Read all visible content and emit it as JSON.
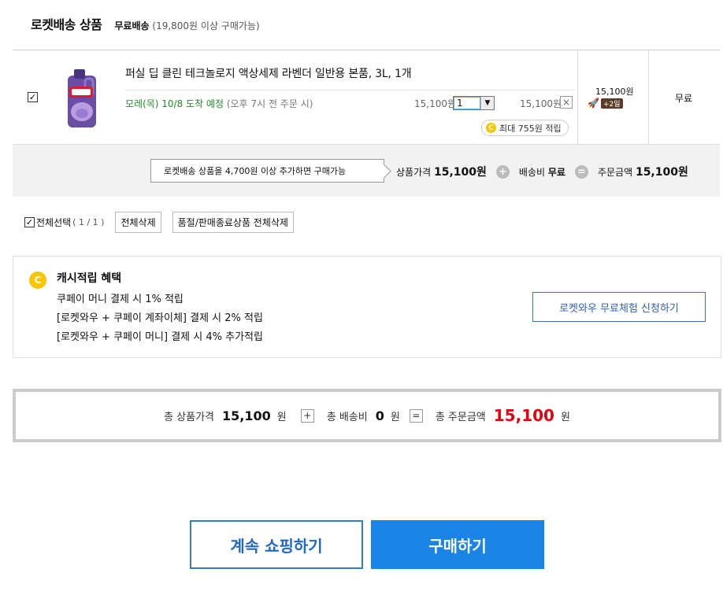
{
  "section": {
    "title": "로켓배송 상품",
    "free_label": "무료배송",
    "free_condition": "(19,800원 이상 구매가능)"
  },
  "item": {
    "checked": true,
    "check_mark": "✓",
    "name": "퍼실 딥 클린 테크놀로지 액상세제 라벤더 일반용 본품, 3L, 1개",
    "arrival": "모레(목) 10/8 도착 예정",
    "arrival_note": "(오후 7시 전 주문 시)",
    "unit_price": "15,100원",
    "quantity": "1",
    "line_price": "15,100원",
    "delete_label": "×",
    "cash_max": "최대 755원 적립",
    "coin_letter": "C",
    "ship_price": "15,100원",
    "rocket_plus": "+2일",
    "shipping_fee": "무료"
  },
  "summary": {
    "tip": "로켓배송 상품을 4,700원 이상 추가하면 구매가능",
    "product_label": "상품가격",
    "product_value": "15,100원",
    "plus": "+",
    "shipping_label": "배송비",
    "shipping_value": "무료",
    "equals": "=",
    "order_label": "주문금액",
    "order_value": "15,100원"
  },
  "bulk": {
    "select_all_label": "전체선택",
    "count": "( 1 / 1 )",
    "delete_all": "전체삭제",
    "delete_soldout": "품절/판매종료상품 전체삭제"
  },
  "cash": {
    "coin_letter": "C",
    "title": "캐시적립 혜택",
    "lines": [
      "쿠페이 머니 결제 시 1% 적립",
      "[로켓와우 + 쿠페이 계좌이체] 결제 시 2% 적립",
      "[로켓와우 + 쿠페이 머니] 결제 시 4% 추가적립"
    ],
    "wow_button": "로켓와우 무료체험 신청하기"
  },
  "total": {
    "product_label": "총 상품가격",
    "product_value": "15,100",
    "won": "원",
    "plus": "+",
    "shipping_label": "총 배송비",
    "shipping_value": "0",
    "equals": "=",
    "order_label": "총 주문금액",
    "order_value": "15,100"
  },
  "actions": {
    "continue": "계속 쇼핑하기",
    "buy": "구매하기"
  },
  "colors": {
    "primary": "#1a83e6",
    "total_red": "#e4000f",
    "arrival_green": "#208e25",
    "coin": "#f7c600"
  }
}
